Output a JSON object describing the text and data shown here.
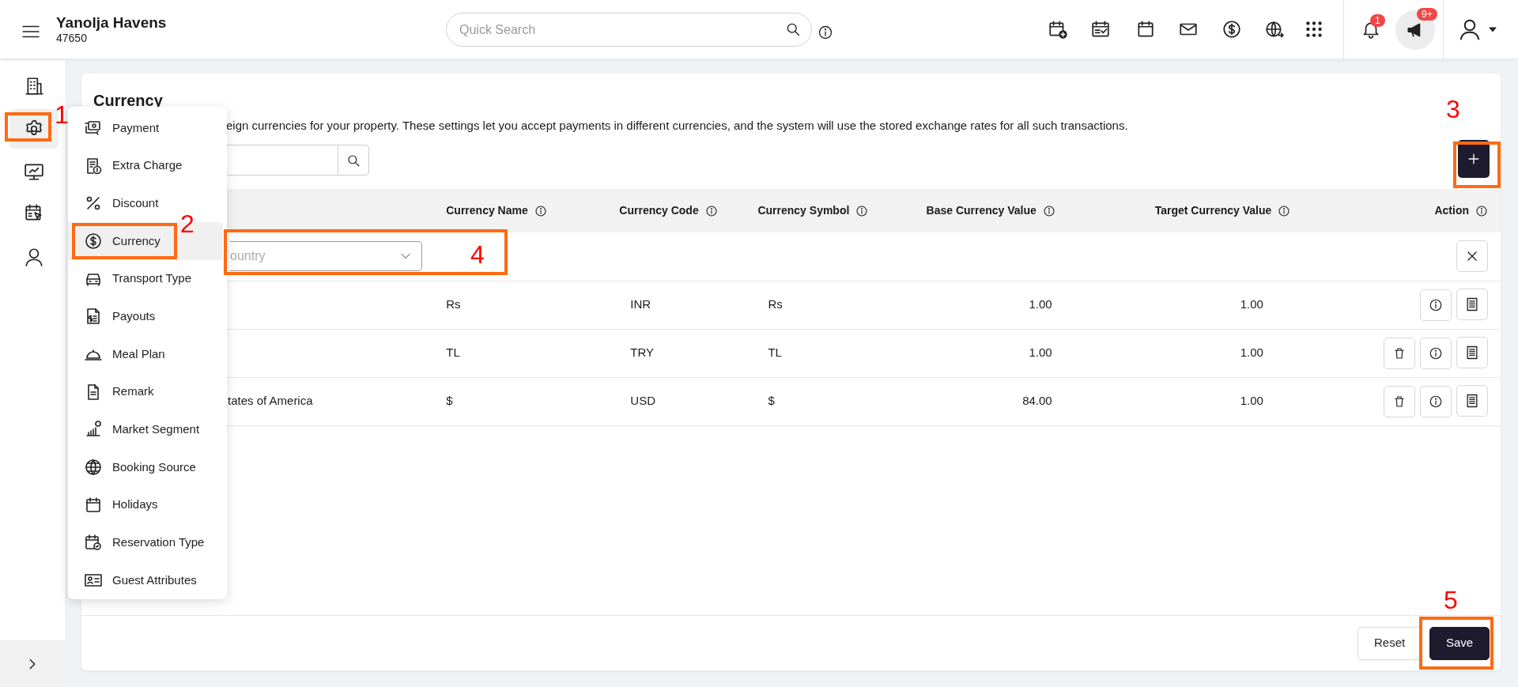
{
  "header": {
    "property_name": "Yanolja Havens",
    "property_code": "47650",
    "search": {
      "placeholder": "Quick Search"
    },
    "notification_badge": "1",
    "announcement_badge": "9+"
  },
  "sidebar": {
    "items": [
      {
        "selected": false
      },
      {
        "selected": true
      },
      {
        "selected": false
      },
      {
        "selected": false
      },
      {
        "selected": false
      }
    ]
  },
  "settings_menu": {
    "items": [
      {
        "label": "Payment",
        "selected": false
      },
      {
        "label": "Extra Charge",
        "selected": false
      },
      {
        "label": "Discount",
        "selected": false
      },
      {
        "label": "Currency",
        "selected": true
      },
      {
        "label": "Transport Type",
        "selected": false
      },
      {
        "label": "Payouts",
        "selected": false
      },
      {
        "label": "Meal Plan",
        "selected": false
      },
      {
        "label": "Remark",
        "selected": false
      },
      {
        "label": "Market Segment",
        "selected": false
      },
      {
        "label": "Booking Source",
        "selected": false
      },
      {
        "label": "Holidays",
        "selected": false
      },
      {
        "label": "Reservation Type",
        "selected": false
      },
      {
        "label": "Guest Attributes",
        "selected": false
      }
    ]
  },
  "page": {
    "title": "Currency",
    "description": "eign currencies for your property. These settings let you accept payments in different currencies, and the system will use the stored exchange rates for all such transactions."
  },
  "table": {
    "columns": [
      "Currency Name",
      "Currency Code",
      "Currency Symbol",
      "Base Currency Value",
      "Target Currency Value",
      "Action"
    ],
    "filter_row": {
      "placeholder": "ountry"
    },
    "rows": [
      {
        "currency_name": "Rs",
        "currency_code": "INR",
        "currency_symbol": "Rs",
        "base_value": "1.00",
        "target_value": "1.00",
        "deletable": false
      },
      {
        "currency_name": "TL",
        "currency_code": "TRY",
        "currency_symbol": "TL",
        "base_value": "1.00",
        "target_value": "1.00",
        "deletable": true
      },
      {
        "column_1": "tates of America",
        "currency_name": "$",
        "currency_code": "USD",
        "currency_symbol": "$",
        "base_value": "84.00",
        "target_value": "1.00",
        "deletable": true
      }
    ]
  },
  "footer": {
    "buttons": [
      {
        "label": "Reset",
        "kind": "secondary"
      },
      {
        "label": "Save",
        "kind": "primary"
      }
    ]
  },
  "callouts": [
    {
      "number": "1"
    },
    {
      "number": "2"
    },
    {
      "number": "3"
    },
    {
      "number": "4"
    },
    {
      "number": "5"
    }
  ]
}
